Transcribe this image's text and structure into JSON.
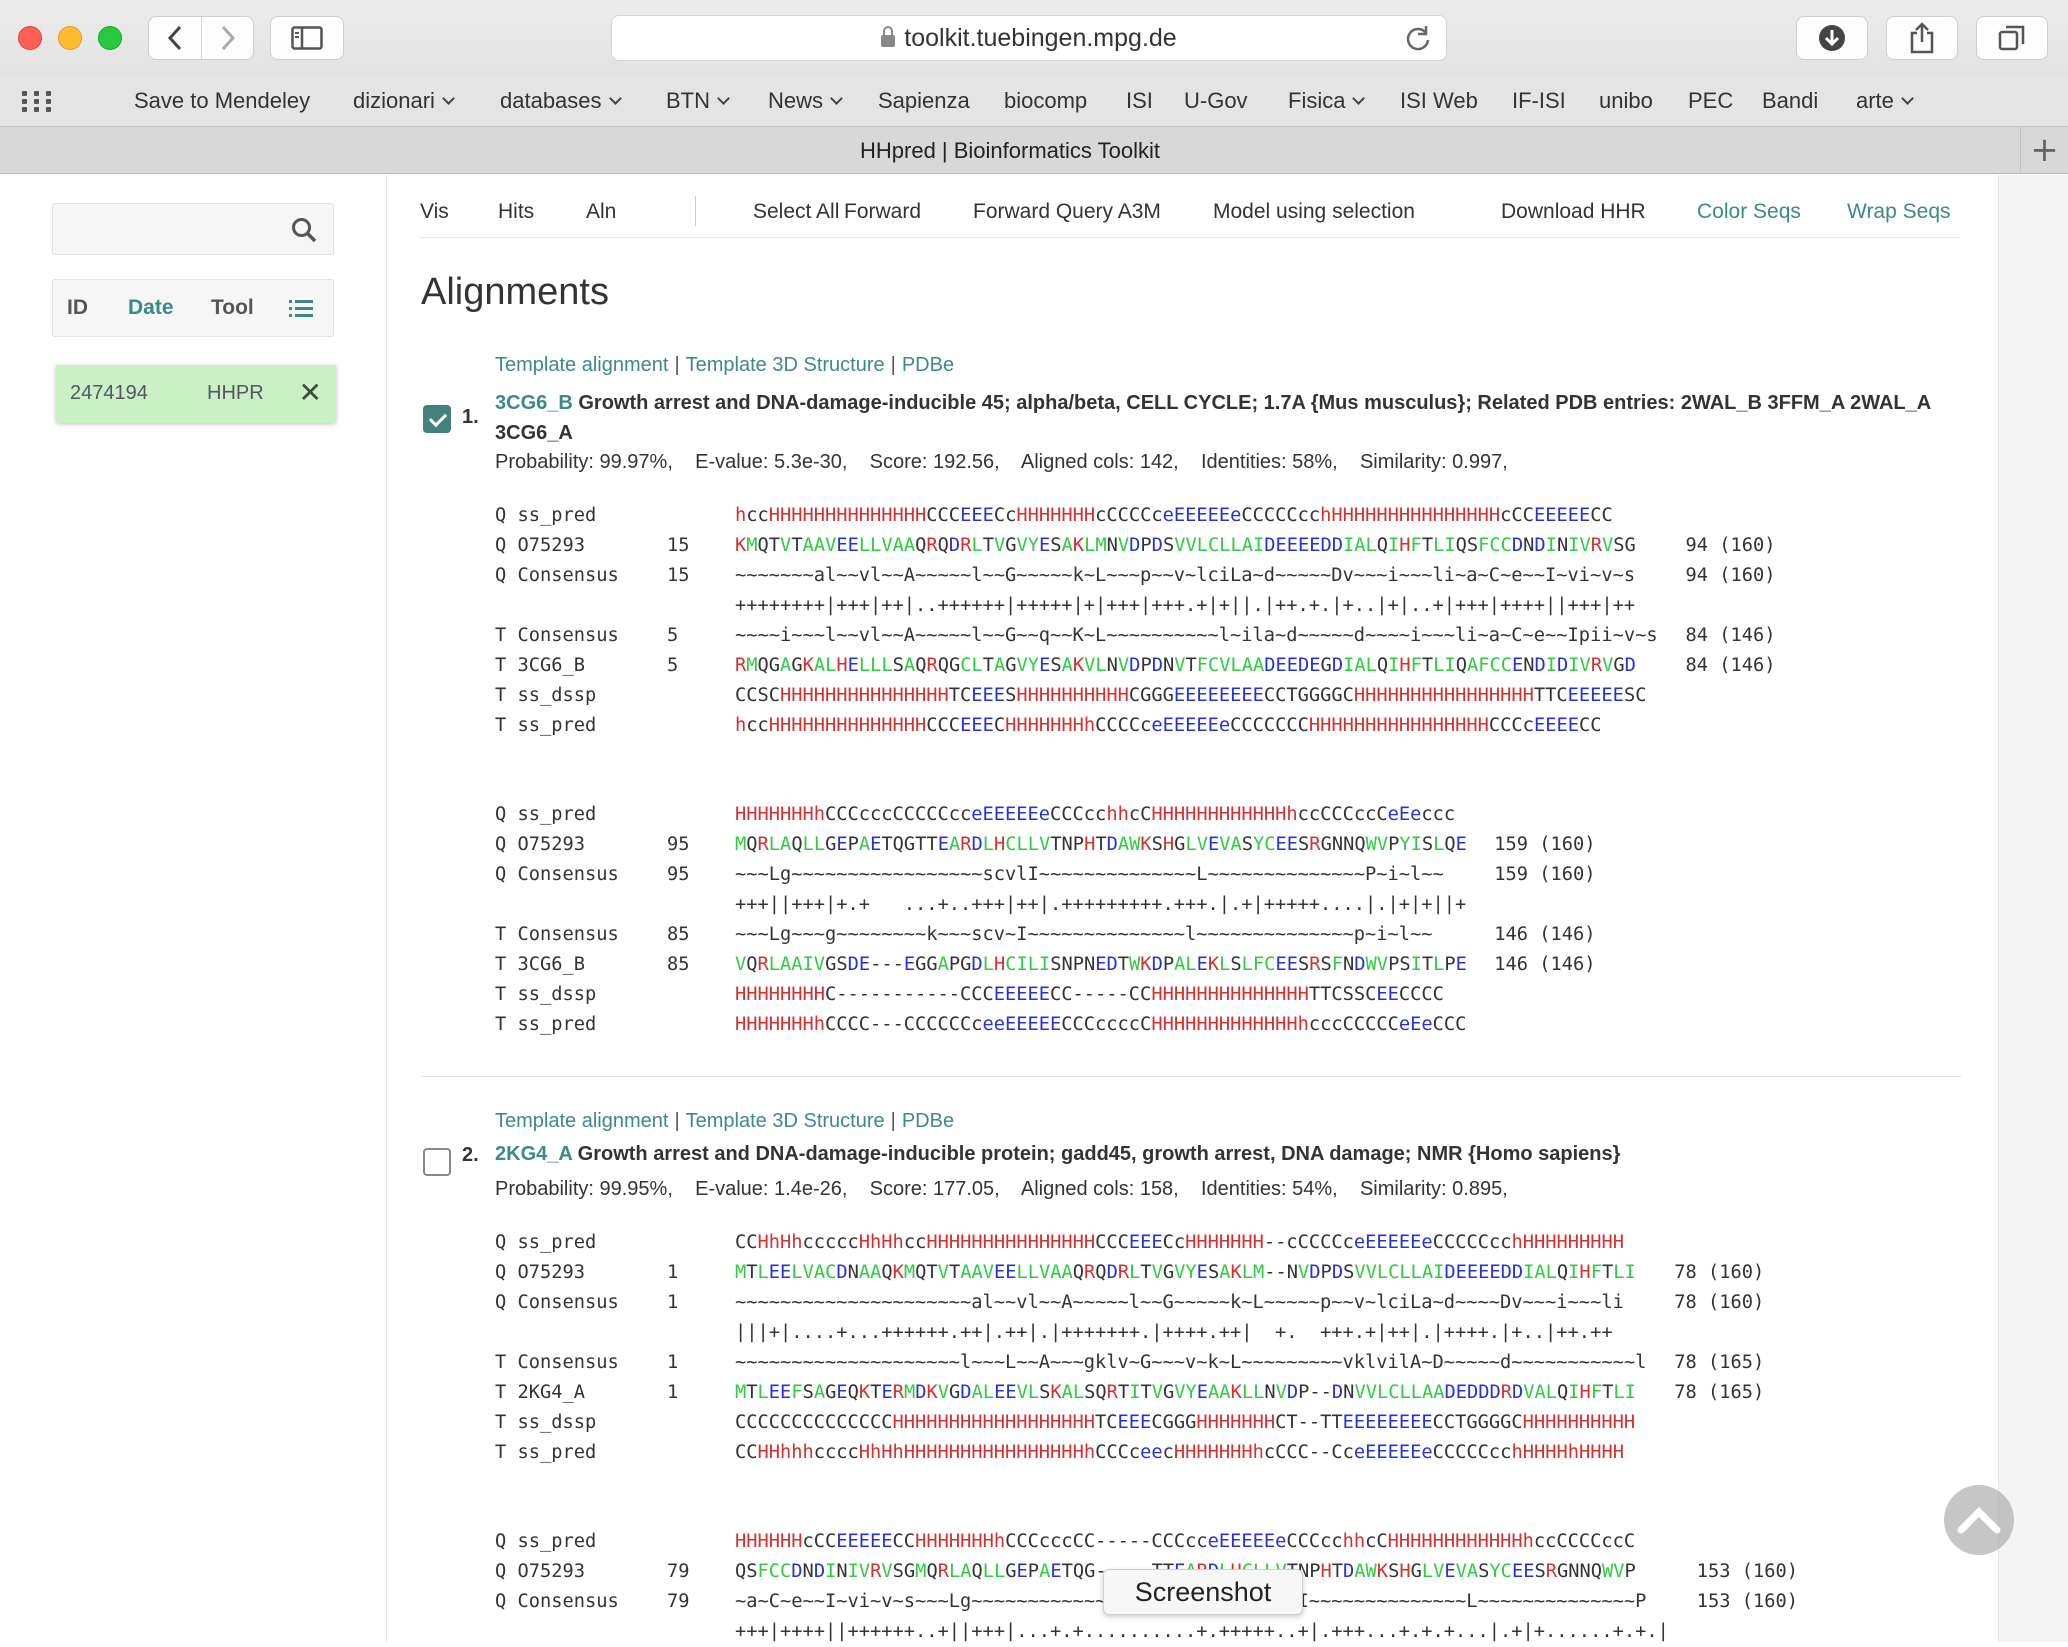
{
  "browser": {
    "url": "toolkit.tuebingen.mpg.de",
    "tab_title": "HHpred | Bioinformatics Toolkit",
    "new_tab": "+"
  },
  "bookmarks": [
    {
      "label": "Save to Mendeley",
      "folder": false
    },
    {
      "label": "dizionari",
      "folder": true
    },
    {
      "label": "databases",
      "folder": true
    },
    {
      "label": "BTN",
      "folder": true
    },
    {
      "label": "News",
      "folder": true
    },
    {
      "label": "Sapienza",
      "folder": false
    },
    {
      "label": "biocomp",
      "folder": false
    },
    {
      "label": "ISI",
      "folder": false
    },
    {
      "label": "U-Gov",
      "folder": false
    },
    {
      "label": "Fisica",
      "folder": true
    },
    {
      "label": "ISI Web",
      "folder": false
    },
    {
      "label": "IF-ISI",
      "folder": false
    },
    {
      "label": "unibo",
      "folder": false
    },
    {
      "label": "PEC",
      "folder": false
    },
    {
      "label": "Bandi",
      "folder": false
    },
    {
      "label": "arte",
      "folder": true
    }
  ],
  "sidebar": {
    "search_placeholder": "",
    "headers": {
      "id": "ID",
      "date": "Date",
      "tool": "Tool"
    },
    "job": {
      "id": "2474194",
      "tool": "HHPR",
      "close": "✕"
    }
  },
  "toolbar": {
    "vis": "Vis",
    "hits": "Hits",
    "aln": "Aln",
    "select_all": "Select All",
    "forward": "Forward",
    "forward_query": "Forward Query A3M",
    "model": "Model using selection",
    "download": "Download HHR",
    "color_seqs": "Color Seqs",
    "wrap_seqs": "Wrap Seqs"
  },
  "heading": "Alignments",
  "hit_links": {
    "template_alignment": "Template alignment",
    "template_3d": "Template 3D Structure",
    "pdbe": "PDBe",
    "sep": "|"
  },
  "hits": [
    {
      "num": "1.",
      "checked": true,
      "id": "3CG6_B",
      "desc": "Growth arrest and DNA-damage-inducible 45; alpha/beta, CELL CYCLE; 1.7A {Mus musculus}; Related PDB entries: 2WAL_B 3FFM_A 2WAL_A 3CG6_A",
      "stats": "Probability: 99.97%,    E-value: 5.3e-30,    Score: 192.56,    Aligned cols: 142,    Identities: 58%,    Similarity: 0.997,",
      "blocks": [
        [
          {
            "lbl": "Q ss_pred",
            "pos": "",
            "seq": "hccHHHHHHHHHHHHHHCCCEEECcHHHHHHHcCCCCceEEEEEeCCCCCcchHHHHHHHHHHHHHHHcCCEEEEECC",
            "end": "",
            "color": "ss"
          },
          {
            "lbl": "Q O75293",
            "pos": "15",
            "seq": "KMQTVTAAVEELLVAAQRQDRLTVGVYESAKLMNVDPDSVVLCLLAIDEEEEDDIALQIHFTLIQSFCCDNDINIVRVSG",
            "end": "94 (160)",
            "color": "aa"
          },
          {
            "lbl": "Q Consensus",
            "pos": "15",
            "seq": "~~~~~~~al~~vl~~A~~~~~l~~G~~~~~k~L~~~p~~v~lciLa~d~~~~~Dv~~~i~~~li~a~C~e~~I~vi~v~s",
            "end": "94 (160)",
            "color": ""
          },
          {
            "lbl": "",
            "pos": "",
            "seq": "++++++++|+++|++|..++++++|+++++|+|+++|+++.+|+||.|++.+.|+..|+|..+|+++|++++||+++|++",
            "end": "",
            "color": ""
          },
          {
            "lbl": "T Consensus",
            "pos": "5",
            "seq": "~~~~i~~~l~~vl~~A~~~~~l~~G~~q~~K~L~~~~~~~~~~l~ila~d~~~~~d~~~~i~~~li~a~C~e~~Ipii~v~s",
            "end": "84 (146)",
            "color": ""
          },
          {
            "lbl": "T 3CG6_B",
            "pos": "5",
            "seq": "RMQGAGKALHELLLSAQRQGCLTAGVYESAKVLNVDPDNVTFCVLAADEEDEGDIALQIHFTLIQAFCCENDIDIVRVGD",
            "end": "84 (146)",
            "color": "aa"
          },
          {
            "lbl": "T ss_dssp",
            "pos": "",
            "seq": "CCSCHHHHHHHHHHHHHHHTCEEESHHHHHHHHHHCGGGEEEEEEEECCTGGGGCHHHHHHHHHHHHHHHHTTCEEEEESC",
            "end": "",
            "color": "ss"
          },
          {
            "lbl": "T ss_pred",
            "pos": "",
            "seq": "hccHHHHHHHHHHHHHHCCCEEECHHHHHHHhCCCCceEEEEEeCCCCCCCHHHHHHHHHHHHHHHHCCCcEEEECC",
            "end": "",
            "color": "ss"
          }
        ],
        [
          {
            "lbl": "Q ss_pred",
            "pos": "",
            "seq": "HHHHHHHhCCCcccCCCCCcceEEEEEeCCCcchhcCHHHHHHHHHHHHhccCCCccCeEeccc",
            "end": "",
            "color": "ss"
          },
          {
            "lbl": "Q O75293",
            "pos": "95",
            "seq": "MQRLAQLLGEPAETQGTTEARDLHCLLVTNPHTDAWKSHGLVEVASYCEESRGNNQWVPYISLQE",
            "end": "159 (160)",
            "color": "aa"
          },
          {
            "lbl": "Q Consensus",
            "pos": "95",
            "seq": "~~~Lg~~~~~~~~~~~~~~~~~scvlI~~~~~~~~~~~~~~L~~~~~~~~~~~~~~P~i~l~~",
            "end": "159 (160)",
            "color": ""
          },
          {
            "lbl": "",
            "pos": "",
            "seq": "+++||+++|+.+   ...+..+++|++|.+++++++++.+++.|.+|+++++....|.|+|+||+",
            "end": "",
            "color": ""
          },
          {
            "lbl": "T Consensus",
            "pos": "85",
            "seq": "~~~Lg~~~g~~~~~~~~k~~~scv~I~~~~~~~~~~~~~~l~~~~~~~~~~~~~~p~i~l~~",
            "end": "146 (146)",
            "color": ""
          },
          {
            "lbl": "T 3CG6_B",
            "pos": "85",
            "seq": "VQRLAAIVGSDE---EGGAPGDLHCILISNPNEDTWKDPALEKLSLFCEESRSFNDWVPSITLPE",
            "end": "146 (146)",
            "color": "aa"
          },
          {
            "lbl": "T ss_dssp",
            "pos": "",
            "seq": "HHHHHHHHC-----------CCCEEEEECC-----CCHHHHHHHHHHHHHHTTCSSCEECCCC",
            "end": "",
            "color": "ss"
          },
          {
            "lbl": "T ss_pred",
            "pos": "",
            "seq": "HHHHHHHhCCCC---CCCCCCceeEEEEECCCccccCHHHHHHHHHHHHHhcccCCCCCeEeCCC",
            "end": "",
            "color": "ss"
          }
        ]
      ]
    },
    {
      "num": "2.",
      "checked": false,
      "id": "2KG4_A",
      "desc": "Growth arrest and DNA-damage-inducible protein; gadd45, growth arrest, DNA damage; NMR {Homo sapiens}",
      "stats": "Probability: 99.95%,    E-value: 1.4e-26,    Score: 177.05,    Aligned cols: 158,    Identities: 54%,    Similarity: 0.895,",
      "blocks": [
        [
          {
            "lbl": "Q ss_pred",
            "pos": "",
            "seq": "CCHhHhcccccHhHhccHHHHHHHHHHHHHHHCCCEEECcHHHHHHH--cCCCCceEEEEEeCCCCCcchHHHHHHHHH",
            "end": "",
            "color": "ss"
          },
          {
            "lbl": "Q O75293",
            "pos": "1",
            "seq": "MTLEELVACDNAAQKMQTVTAAVEELLVAAQRQDRLTVGVYESAKLM--NVDPDSVVLCLLAIDEEEEDDIALQIHFTLI",
            "end": "78 (160)",
            "color": "aa"
          },
          {
            "lbl": "Q Consensus",
            "pos": "1",
            "seq": "~~~~~~~~~~~~~~~~~~~~~al~~vl~~A~~~~~l~~G~~~~~k~L~~~~~p~~v~lciLa~d~~~~Dv~~~i~~~li",
            "end": "78 (160)",
            "color": ""
          },
          {
            "lbl": "",
            "pos": "",
            "seq": "|||+|....+...++++++.++|.++|.|+++++++.|++++.++|  +.  +++.+|++|.|++++.|+..|++.++",
            "end": "",
            "color": ""
          },
          {
            "lbl": "T Consensus",
            "pos": "1",
            "seq": "~~~~~~~~~~~~~~~~~~~~l~~~L~~A~~~gklv~G~~~v~k~L~~~~~~~~~vklvilA~D~~~~~d~~~~~~~~~~~l",
            "end": "78 (165)",
            "color": ""
          },
          {
            "lbl": "T 2KG4_A",
            "pos": "1",
            "seq": "MTLEEFSAGEQKTERMDKVGDALEEVLSKALSQRTITVGVYEAAKLLNVDP--DNVVLCLLAADEDDDRDVALQIHFTLI",
            "end": "78 (165)",
            "color": "aa"
          },
          {
            "lbl": "T ss_dssp",
            "pos": "",
            "seq": "CCCCCCCCCCCCCCHHHHHHHHHHHHHHHHHHTCEEECGGGHHHHHHHCT--TTEEEEEEEECCTGGGGCHHHHHHHHHH",
            "end": "",
            "color": "ss"
          },
          {
            "lbl": "T ss_pred",
            "pos": "",
            "seq": "CCHHhhhccccHhHhHHHHHHHHHHHHHHHHhCCCceecHHHHHHHhcCCC--CceEEEEEeCCCCCcchHHHHhHHHH",
            "end": "",
            "color": "ss"
          }
        ],
        [
          {
            "lbl": "Q ss_pred",
            "pos": "",
            "seq": "HHHHHHcCCEEEEECCHHHHHHHhCCCcccCC-----CCCcceEEEEEeCCCcchhcCHHHHHHHHHHHHhccCCCCccC",
            "end": "",
            "color": "ss"
          },
          {
            "lbl": "Q O75293",
            "pos": "79",
            "seq": "QSFCCDNDINIVRVSGMQRLAQLLGEPAETQG-----TTEARDLHCLLVTNPHTDAWKSHGLVEVASYCEESRGNNQWVP",
            "end": "153 (160)",
            "color": "aa"
          },
          {
            "lbl": "Q Consensus",
            "pos": "79",
            "seq": "~a~C~e~~I~vi~v~s~~~Lg~~~~~~~~~~~~~~~~~~~~~~~~~~~~~I~~~~~~~~~~~~~~L~~~~~~~~~~~~~~P",
            "end": "153 (160)",
            "color": ""
          },
          {
            "lbl": "",
            "pos": "",
            "seq": "+++|++++||++++++..+||+++|...+.+..........+.+++++..+|.+++...+.+.+...|.+|+......+.+.|",
            "end": "",
            "color": ""
          }
        ]
      ]
    }
  ],
  "tooltip": "Screenshot"
}
